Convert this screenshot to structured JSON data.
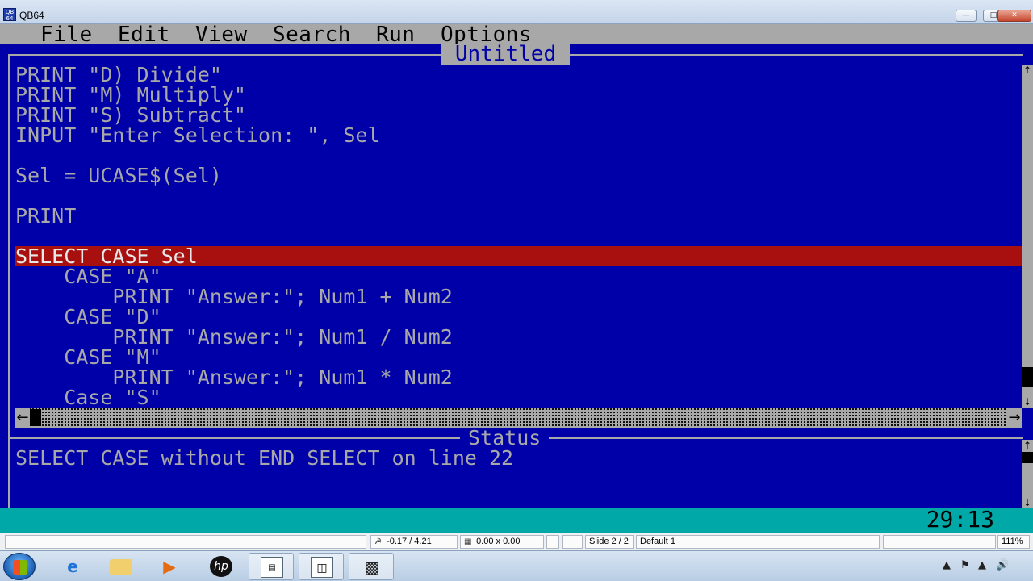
{
  "window": {
    "title": "QB64",
    "buttons": [
      "minimize",
      "maximize",
      "close"
    ]
  },
  "menu": {
    "items": [
      "File",
      "Edit",
      "View",
      "Search",
      "Run",
      "Options"
    ]
  },
  "editor": {
    "title": "Untitled",
    "lines": [
      "PRINT \"D) Divide\"",
      "PRINT \"M) Multiply\"",
      "PRINT \"S) Subtract\"",
      "INPUT \"Enter Selection: \", Sel",
      "",
      "Sel = UCASE$(Sel)",
      "",
      "PRINT",
      "",
      "SELECT CASE Sel",
      "    CASE \"A\"",
      "        PRINT \"Answer:\"; Num1 + Num2",
      "    CASE \"D\"",
      "        PRINT \"Answer:\"; Num1 / Num2",
      "    CASE \"M\"",
      "        PRINT \"Answer:\"; Num1 * Num2",
      "    Case \"S\""
    ],
    "highlighted_line_index": 9
  },
  "status": {
    "title": "Status",
    "message": "SELECT CASE without END SELECT on line 22"
  },
  "cursor_position": "29:13",
  "colors": {
    "background": "#0000a8",
    "text": "#a8a8a8",
    "highlight": "#a81010",
    "bottom_bar": "#00a8a8"
  },
  "office_status": {
    "position": "-0.17 / 4.21",
    "size": "0.00 x 0.00",
    "slide": "Slide 2 / 2",
    "layout": "Default 1",
    "zoom": "111%"
  },
  "taskbar": {
    "items": [
      "start-icon",
      "internet-explorer-icon",
      "file-explorer-icon",
      "media-player-icon",
      "hp-icon",
      "document-viewer-icon",
      "presentation-icon",
      "qb64-icon"
    ]
  }
}
